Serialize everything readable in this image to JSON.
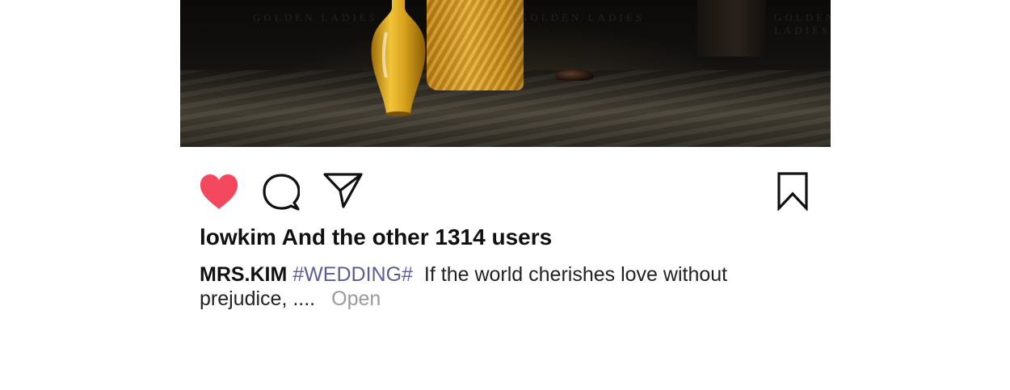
{
  "post": {
    "watermark_text": "GOLDEN LADIES",
    "likes_text": "lowkim And the other 1314 users",
    "caption": {
      "username": "MRS.KIM",
      "hashtag": "#WEDDING#",
      "text_line1": "If the world cherishes love without",
      "text_line2": "prejudice, ....",
      "more_label": "Open"
    }
  },
  "actions": {
    "like_icon": "heart-icon",
    "comment_icon": "comment-bubble-icon",
    "share_icon": "send-icon",
    "bookmark_icon": "bookmark-icon",
    "liked": true
  },
  "colors": {
    "like_active": "#f4485f",
    "hashtag": "#5b5e95",
    "muted": "#9a9a9a"
  }
}
